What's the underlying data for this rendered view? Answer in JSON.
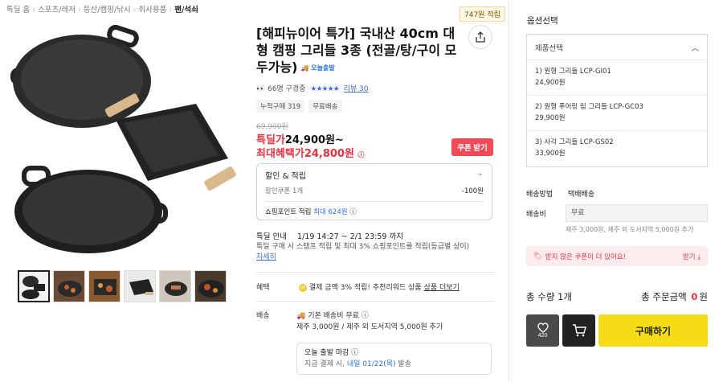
{
  "breadcrumb": {
    "items": [
      "특딜 홈",
      "스포츠/레저",
      "등산/캠핑/낚시",
      "취사용품"
    ],
    "current": "팬/석쇠"
  },
  "points_badge": "747원 적립",
  "product": {
    "title": "[해피뉴이어 특가] 국내산 40cm 대형 캠핑 그리들 3종 (전골/탕/구이 모두가능)",
    "delivery_tag": "오늘출발",
    "viewers": "66명 구경중",
    "review_label": "리뷰 30",
    "tags": [
      "누적구매 319",
      "무료배송"
    ],
    "original_price": "69,900원",
    "deal_label": "특딜가",
    "deal_price": "24,900원~",
    "max_label": "최대혜택가",
    "max_price": "24,800원",
    "coupon_button": "쿠폰 받기",
    "discount": {
      "header": "할인 & 적립",
      "coupon_label": "할인쿠폰 1개",
      "coupon_amount": "-100원",
      "point_label": "쇼핑포인트 적립",
      "point_value": "최대 624원"
    },
    "period": {
      "label": "특딜 안내",
      "range": "1/19 14:27 ~ 2/1 23:59 까지",
      "desc": "특딜 구매 시 스탬프 적립 및 최대 3% 쇼핑포인트를 적립(등급별 상이)",
      "link": "자세히"
    },
    "benefit": {
      "label": "혜택",
      "text": "결제 금액 3% 적립! 추천리워드 상품",
      "link": "상품 더보기"
    },
    "shipping": {
      "label": "배송",
      "line1": "기본 배송비 무료",
      "line2": "제주 3,000원 / 제주 외 도서지역 5,000원 추가",
      "depart_title": "오늘 출발 마감",
      "depart_sub_prefix": "지금 결제 시,",
      "depart_date": "내일 01/22(목)",
      "depart_sub_suffix": "발송"
    }
  },
  "panel": {
    "title": "옵션선택",
    "select_label": "제품선택",
    "options": [
      {
        "name": "1) 원형 그리들 LCP-GI01",
        "price": "24,900원"
      },
      {
        "name": "2) 원형 푸어링 림 그리들 LCP-GC03",
        "price": "29,900원"
      },
      {
        "name": "3) 사각 그리들 LCP-GS02",
        "price": "33,900원"
      }
    ],
    "ship_method_label": "배송방법",
    "ship_method_value": "택배배송",
    "ship_fee_label": "배송비",
    "ship_fee_value": "무료",
    "ship_fee_note": "제주 3,000원, 제주 외 도서지역 5,000원 추가",
    "coupon_banner": "받지 않은 쿠폰이 더 있어요!",
    "coupon_banner_btn": "받기",
    "total_qty": "총 수량 1개",
    "total_amount_label": "총 주문금액",
    "total_amount_num": "0",
    "total_amount_unit": "원",
    "wish_count": "420",
    "buy_button": "구매하기"
  },
  "colors": {
    "accent_red": "#e8333e",
    "link_blue": "#3d6ce8",
    "buy_yellow": "#f5dc16"
  }
}
